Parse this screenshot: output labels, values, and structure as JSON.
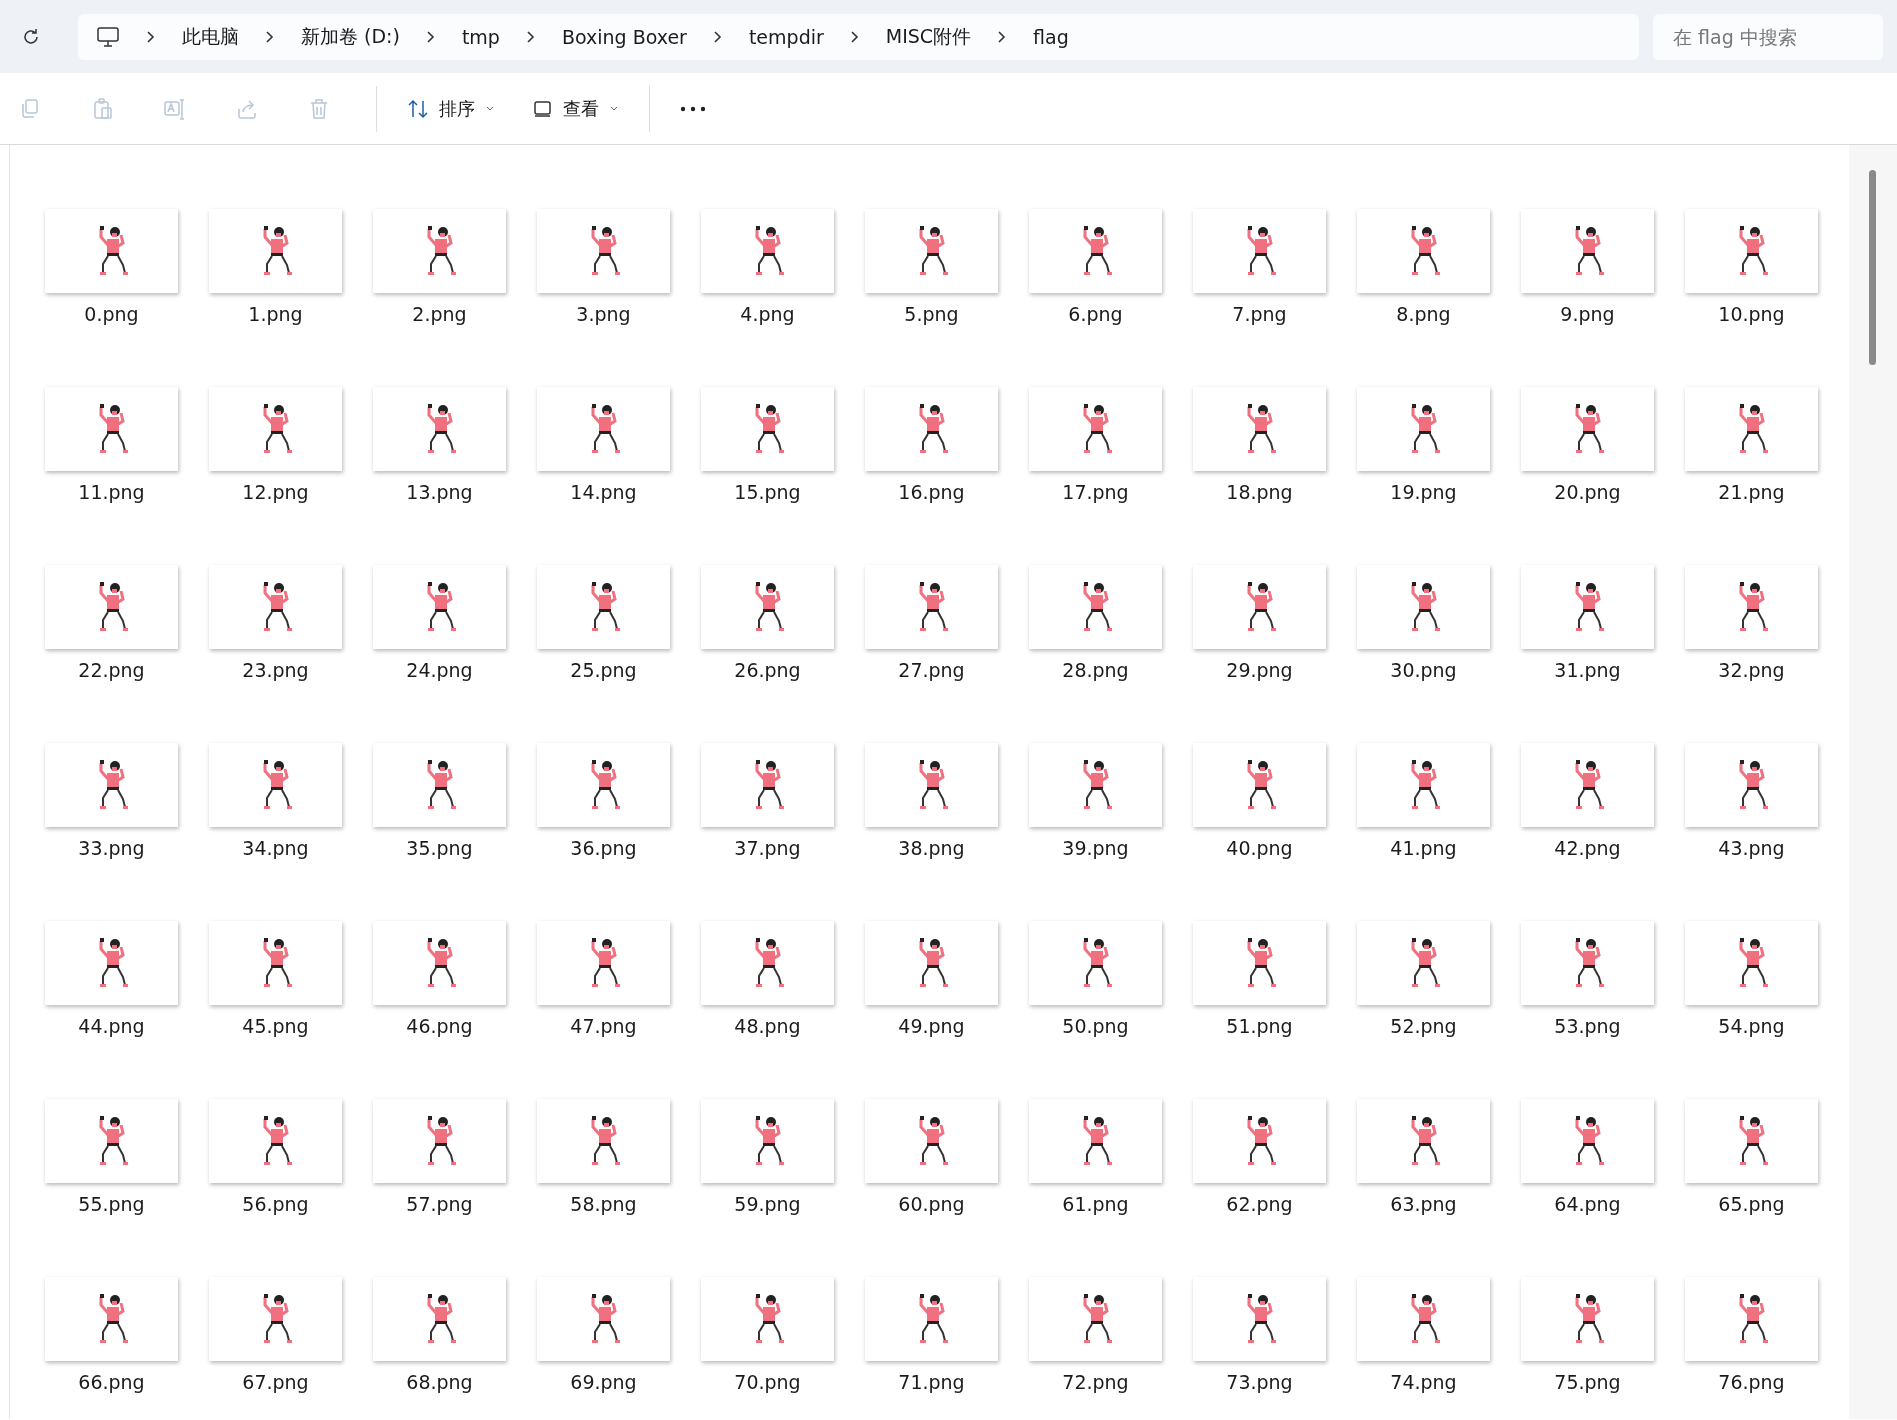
{
  "address_bar": {
    "crumbs": [
      "此电脑",
      "新加卷 (D:)",
      "tmp",
      "Boxing Boxer",
      "tempdir",
      "MISC附件",
      "flag"
    ]
  },
  "search": {
    "placeholder": "在 flag 中搜索"
  },
  "toolbar": {
    "actions": [
      {
        "kind": "copy",
        "disabled": true
      },
      {
        "kind": "paste",
        "disabled": true
      },
      {
        "kind": "rename",
        "disabled": true
      },
      {
        "kind": "share",
        "disabled": true
      },
      {
        "kind": "delete",
        "disabled": true
      }
    ],
    "sort": {
      "label": "排序"
    },
    "view": {
      "label": "查看"
    }
  },
  "files": [
    {
      "name": "0.png"
    },
    {
      "name": "1.png"
    },
    {
      "name": "2.png"
    },
    {
      "name": "3.png"
    },
    {
      "name": "4.png"
    },
    {
      "name": "5.png"
    },
    {
      "name": "6.png"
    },
    {
      "name": "7.png"
    },
    {
      "name": "8.png"
    },
    {
      "name": "9.png"
    },
    {
      "name": "10.png"
    },
    {
      "name": "11.png"
    },
    {
      "name": "12.png"
    },
    {
      "name": "13.png"
    },
    {
      "name": "14.png"
    },
    {
      "name": "15.png"
    },
    {
      "name": "16.png"
    },
    {
      "name": "17.png"
    },
    {
      "name": "18.png"
    },
    {
      "name": "19.png"
    },
    {
      "name": "20.png"
    },
    {
      "name": "21.png"
    },
    {
      "name": "22.png"
    },
    {
      "name": "23.png"
    },
    {
      "name": "24.png"
    },
    {
      "name": "25.png"
    },
    {
      "name": "26.png"
    },
    {
      "name": "27.png"
    },
    {
      "name": "28.png"
    },
    {
      "name": "29.png"
    },
    {
      "name": "30.png"
    },
    {
      "name": "31.png"
    },
    {
      "name": "32.png"
    },
    {
      "name": "33.png"
    },
    {
      "name": "34.png"
    },
    {
      "name": "35.png"
    },
    {
      "name": "36.png"
    },
    {
      "name": "37.png"
    },
    {
      "name": "38.png"
    },
    {
      "name": "39.png"
    },
    {
      "name": "40.png"
    },
    {
      "name": "41.png"
    },
    {
      "name": "42.png"
    },
    {
      "name": "43.png"
    },
    {
      "name": "44.png"
    },
    {
      "name": "45.png"
    },
    {
      "name": "46.png"
    },
    {
      "name": "47.png"
    },
    {
      "name": "48.png"
    },
    {
      "name": "49.png"
    },
    {
      "name": "50.png"
    },
    {
      "name": "51.png"
    },
    {
      "name": "52.png"
    },
    {
      "name": "53.png"
    },
    {
      "name": "54.png"
    },
    {
      "name": "55.png"
    },
    {
      "name": "56.png"
    },
    {
      "name": "57.png"
    },
    {
      "name": "58.png"
    },
    {
      "name": "59.png"
    },
    {
      "name": "60.png"
    },
    {
      "name": "61.png"
    },
    {
      "name": "62.png"
    },
    {
      "name": "63.png"
    },
    {
      "name": "64.png"
    },
    {
      "name": "65.png"
    },
    {
      "name": "66.png"
    },
    {
      "name": "67.png"
    },
    {
      "name": "68.png"
    },
    {
      "name": "69.png"
    },
    {
      "name": "70.png"
    },
    {
      "name": "71.png"
    },
    {
      "name": "72.png"
    },
    {
      "name": "73.png"
    },
    {
      "name": "74.png"
    },
    {
      "name": "75.png"
    },
    {
      "name": "76.png"
    }
  ]
}
